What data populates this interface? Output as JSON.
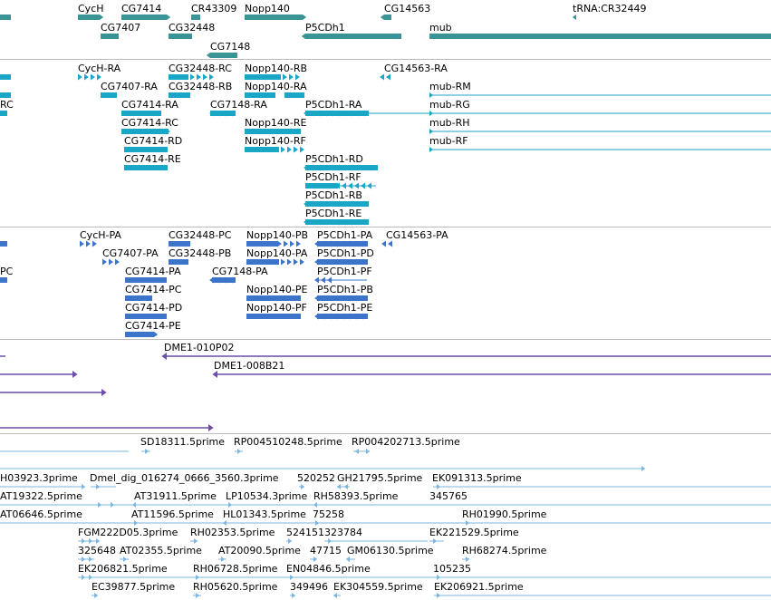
{
  "colors": {
    "gene": "#3a9496",
    "mrna": "#1aa6c6",
    "protein": "#3b74c9",
    "clone": "#6b4fa8",
    "est": "#7eb6de",
    "separator": "#bbbbbb"
  },
  "tracks": {
    "genes": {
      "labels": [
        "CycH",
        "CG7414",
        "CR43309",
        "Nopp140",
        "CG14563",
        "tRNA:CR32449",
        "CG7407",
        "CG32448",
        "P5CDh1",
        "mub",
        "CG7148"
      ]
    },
    "transcripts": {
      "labels": [
        "CycH-RA",
        "CG32448-RC",
        "Nopp140-RB",
        "CG14563-RA",
        "CG7407-RA",
        "CG32448-RB",
        "Nopp140-RA",
        "mub-RM",
        "RC",
        "CG7414-RA",
        "CG7148-RA",
        "P5CDh1-RA",
        "mub-RG",
        "CG7414-RC",
        "Nopp140-RE",
        "mub-RH",
        "CG7414-RD",
        "Nopp140-RF",
        "mub-RF",
        "CG7414-RE",
        "P5CDh1-RD",
        "P5CDh1-RF",
        "P5CDh1-RB",
        "P5CDh1-RE"
      ]
    },
    "proteins": {
      "labels": [
        "CycH-PA",
        "CG32448-PC",
        "Nopp140-PB",
        "P5CDh1-PA",
        "CG14563-PA",
        "CG7407-PA",
        "CG32448-PB",
        "Nopp140-PA",
        "P5CDh1-PD",
        "PC",
        "CG7414-PA",
        "CG7148-PA",
        "P5CDh1-PF",
        "CG7414-PC",
        "Nopp140-PE",
        "P5CDh1-PB",
        "CG7414-PD",
        "Nopp140-PF",
        "P5CDh1-PE",
        "CG7414-PE"
      ]
    },
    "clones": {
      "labels": [
        "DME1-010P02",
        "DME1-008B21"
      ]
    },
    "ests": {
      "labels": [
        "SD18311.5prime",
        "RP004510248.5prime",
        "RP004202713.5prime",
        "H03923.3prime",
        "Dmel_dig_016274_0666_3560.3prime",
        "520252",
        "GH21795.5prime",
        "EK091313.5prime",
        "AT19322.5prime",
        "AT31911.5prime",
        "LP10534.3prime",
        "RH58393.5prime",
        "345765",
        "AT06646.5prime",
        "AT11596.5prime",
        "HL01343.5prime",
        "75258",
        "RH01990.5prime",
        "FGM222D05.3prime",
        "RH02353.5prime",
        "524151",
        "323784",
        "EK221529.5prime",
        "325648",
        "AT02355.5prime",
        "AT20090.5prime",
        "47715",
        "GM06130.5prime",
        "RH68274.5prime",
        "EK206821.5prime",
        "RH06728.5prime",
        "EN04846.5prime",
        "105235",
        "EC39877.5prime",
        "RH05620.5prime",
        "349496",
        "EK304559.5prime",
        "EK206921.5prime"
      ]
    }
  }
}
